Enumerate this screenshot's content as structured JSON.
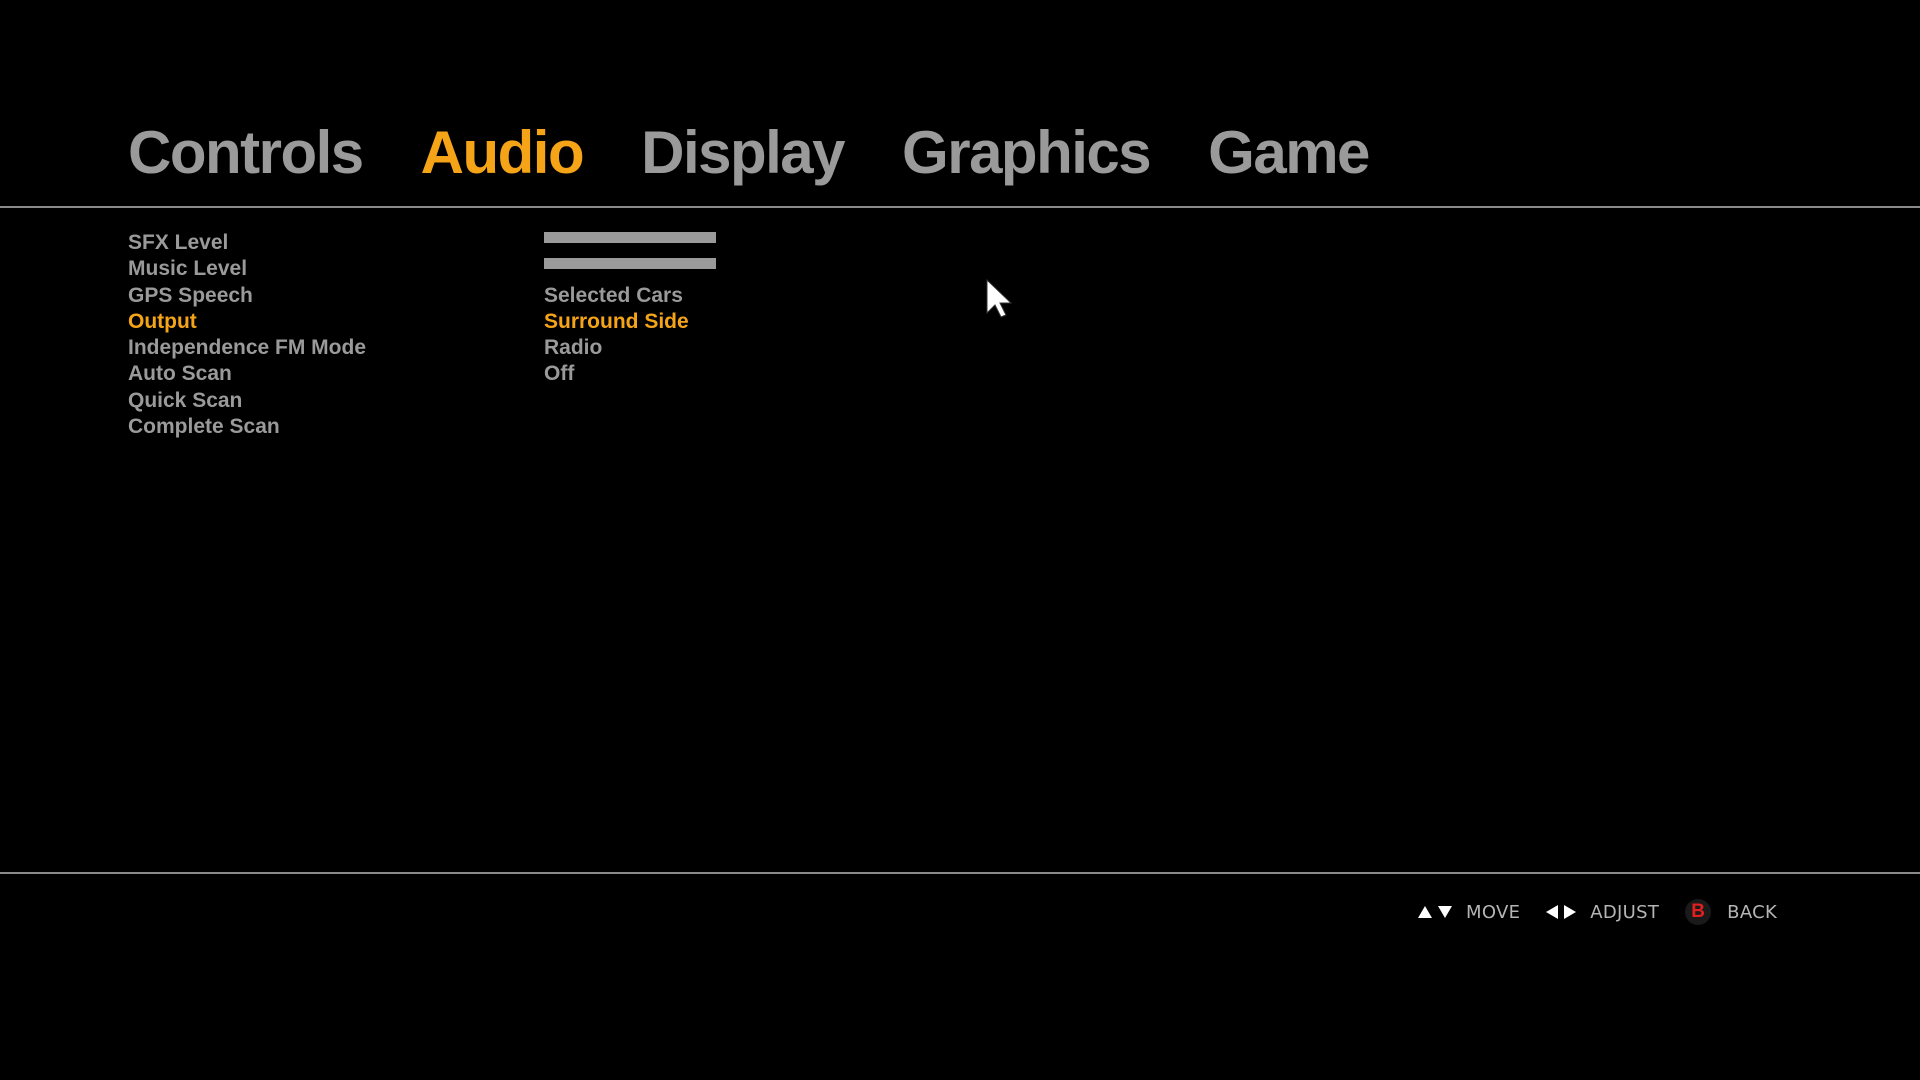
{
  "tabs": [
    {
      "label": "Controls",
      "active": false
    },
    {
      "label": "Audio",
      "active": true
    },
    {
      "label": "Display",
      "active": false
    },
    {
      "label": "Graphics",
      "active": false
    },
    {
      "label": "Game",
      "active": false
    }
  ],
  "settings": [
    {
      "label": "SFX Level",
      "value_type": "slider",
      "level": 1.0,
      "active": false
    },
    {
      "label": "Music Level",
      "value_type": "slider",
      "level": 1.0,
      "active": false
    },
    {
      "label": "GPS Speech",
      "value": "Selected Cars",
      "active": false
    },
    {
      "label": "Output",
      "value": "Surround Side",
      "active": true
    },
    {
      "label": "Independence FM Mode",
      "value": "Radio",
      "active": false
    },
    {
      "label": "Auto Scan",
      "value": "Off",
      "active": false
    },
    {
      "label": "Quick Scan",
      "value": "",
      "active": false
    },
    {
      "label": "Complete Scan",
      "value": "",
      "active": false
    }
  ],
  "hints": {
    "move": "MOVE",
    "adjust": "ADJUST",
    "back_button": "B",
    "back": "BACK"
  },
  "colors": {
    "active": "#f5a417",
    "inactive": "#9a9a9a",
    "background": "#000000",
    "back_button": "#e01f1f"
  },
  "icons": {
    "move": [
      "triangle-up-icon",
      "triangle-down-icon"
    ],
    "adjust": [
      "triangle-left-icon",
      "triangle-right-icon"
    ],
    "cursor": "mouse-pointer-icon"
  }
}
